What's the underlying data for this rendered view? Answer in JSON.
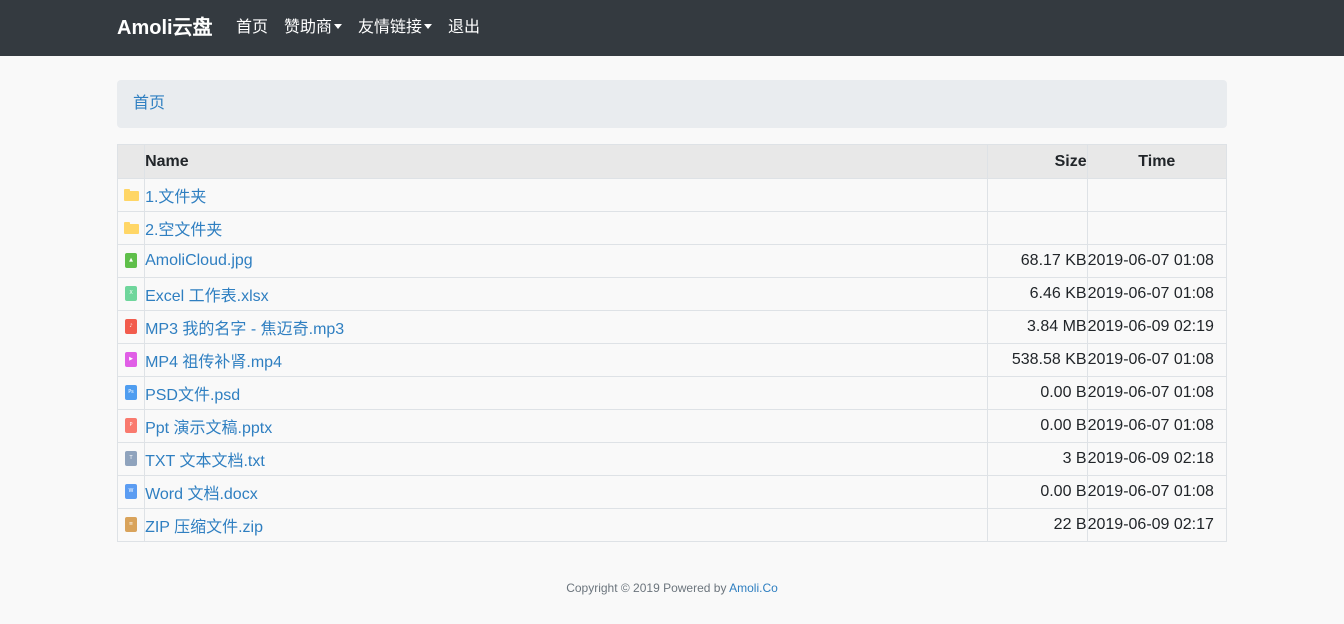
{
  "navbar": {
    "brand": "Amoli云盘",
    "links": [
      {
        "label": "首页",
        "dropdown": false
      },
      {
        "label": "赞助商",
        "dropdown": true
      },
      {
        "label": "友情链接",
        "dropdown": true
      },
      {
        "label": "退出",
        "dropdown": false
      }
    ]
  },
  "breadcrumb": {
    "current": "首页"
  },
  "table": {
    "headers": {
      "name": "Name",
      "size": "Size",
      "time": "Time"
    },
    "rows": [
      {
        "icon": "folder-icon",
        "color": "#ffd666",
        "name": "1.文件夹",
        "size": "",
        "time": ""
      },
      {
        "icon": "folder-icon",
        "color": "#ffd666",
        "name": "2.空文件夹",
        "size": "",
        "time": ""
      },
      {
        "icon": "image-file-icon",
        "color": "#5fbf4a",
        "name": "AmoliCloud.jpg",
        "size": "68.17 KB",
        "time": "2019-06-07 01:08"
      },
      {
        "icon": "excel-file-icon",
        "color": "#6fd69c",
        "name": "Excel 工作表.xlsx",
        "size": "6.46 KB",
        "time": "2019-06-07 01:08"
      },
      {
        "icon": "audio-file-icon",
        "color": "#f25c4d",
        "name": "MP3 我的名字 - 焦迈奇.mp3",
        "size": "3.84 MB",
        "time": "2019-06-09 02:19"
      },
      {
        "icon": "video-file-icon",
        "color": "#e05ee6",
        "name": "MP4 祖传补肾.mp4",
        "size": "538.58 KB",
        "time": "2019-06-07 01:08"
      },
      {
        "icon": "psd-file-icon",
        "color": "#4f9df0",
        "name": "PSD文件.psd",
        "size": "0.00 B",
        "time": "2019-06-07 01:08"
      },
      {
        "icon": "ppt-file-icon",
        "color": "#f97a6e",
        "name": "Ppt 演示文稿.pptx",
        "size": "0.00 B",
        "time": "2019-06-07 01:08"
      },
      {
        "icon": "text-file-icon",
        "color": "#8fa3bd",
        "name": "TXT 文本文档.txt",
        "size": "3 B",
        "time": "2019-06-09 02:18"
      },
      {
        "icon": "word-file-icon",
        "color": "#5b9cf2",
        "name": "Word 文档.docx",
        "size": "0.00 B",
        "time": "2019-06-07 01:08"
      },
      {
        "icon": "zip-file-icon",
        "color": "#d9a35b",
        "name": "ZIP 压缩文件.zip",
        "size": "22 B",
        "time": "2019-06-09 02:17"
      }
    ]
  },
  "footer": {
    "text": "Copyright © 2019 Powered by ",
    "link": "Amoli.Co"
  }
}
